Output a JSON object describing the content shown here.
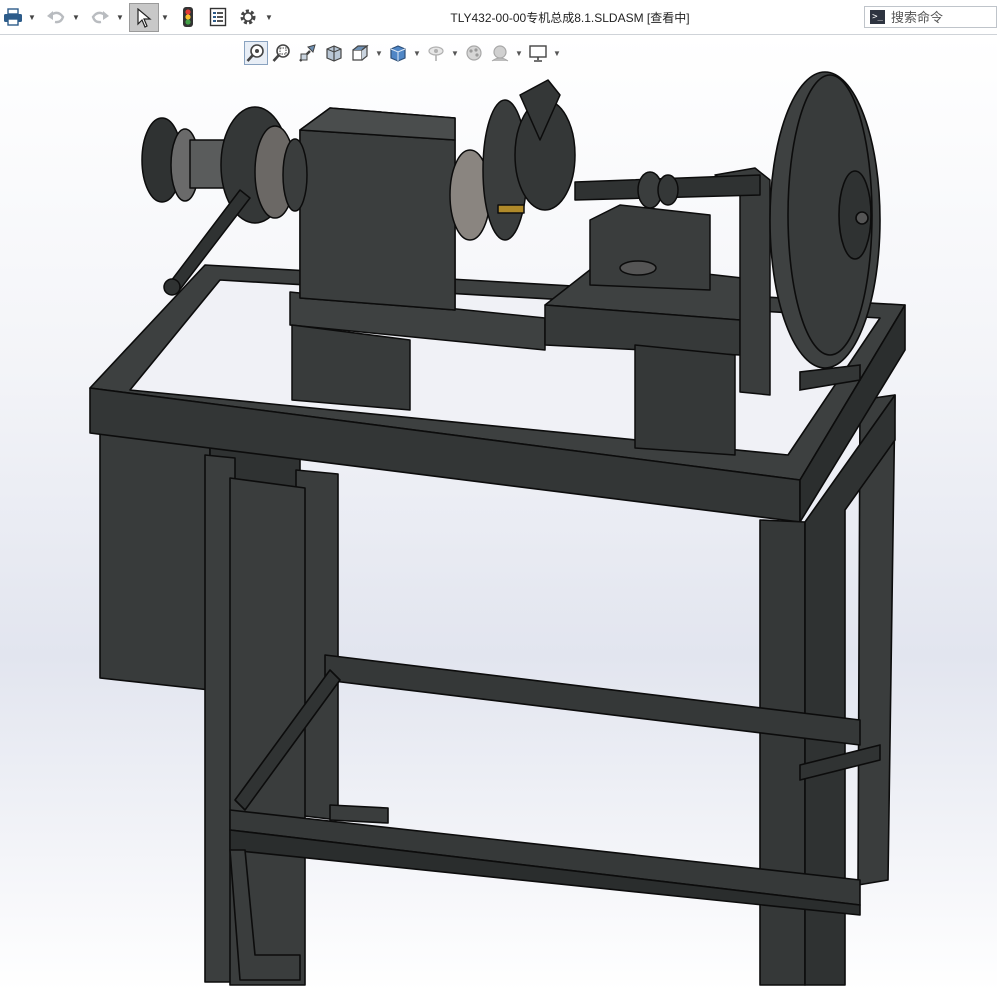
{
  "window": {
    "title": "TLY432-00-00专机总成8.1.SLDASM [查看中]"
  },
  "toolbar": {
    "items": [
      "print-icon",
      "undo-icon",
      "redo-icon",
      "select-pointer-icon",
      "rebuild-traffic-light-icon",
      "file-properties-icon",
      "options-gear-icon"
    ]
  },
  "search": {
    "placeholder": "搜索命令",
    "prompt_glyph": ">_"
  },
  "heads_up_toolbar": {
    "items": [
      "zoom-to-fit-icon",
      "zoom-to-area-icon",
      "previous-view-icon",
      "section-view-icon",
      "view-orientation-icon",
      "display-style-icon",
      "hide-show-items-icon",
      "edit-appearance-icon",
      "apply-scene-icon",
      "view-settings-icon"
    ]
  },
  "colors": {
    "model_body": "#3a3d3d",
    "model_edge": "#0c0c0c",
    "select_active": "#c8c8c8",
    "hud_active": "#e8eef6"
  }
}
